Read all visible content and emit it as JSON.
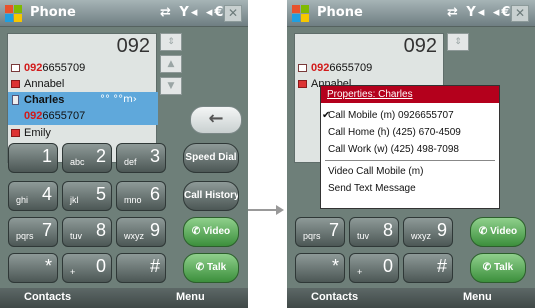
{
  "left": {
    "title": "Phone",
    "title_icons": "⇄ Y◂ ◂€",
    "close": "✕",
    "dial": "092",
    "expand": "⇕",
    "contacts": [
      {
        "prefix": "092",
        "rest": "6655709",
        "icon": "doc"
      },
      {
        "name": "Annabel",
        "icon": "red"
      },
      {
        "name": "Charles",
        "icon": "phone",
        "num_prefix": "092",
        "num_rest": "6655707",
        "dots": "°°  °°m›"
      },
      {
        "name": "Emily",
        "icon": "red"
      }
    ],
    "scroll_up": "▲",
    "scroll_down": "▼",
    "back": "←",
    "keys": [
      {
        "big": "1",
        "small": ""
      },
      {
        "big": "2",
        "small": "abc"
      },
      {
        "big": "3",
        "small": "def"
      },
      {
        "big": "4",
        "small": "ghi"
      },
      {
        "big": "5",
        "small": "jkl"
      },
      {
        "big": "6",
        "small": "mno"
      },
      {
        "big": "7",
        "small": "pqrs"
      },
      {
        "big": "8",
        "small": "tuv"
      },
      {
        "big": "9",
        "small": "wxyz"
      },
      {
        "big": "*",
        "small": ""
      },
      {
        "big": "0",
        "small": "+"
      },
      {
        "big": "#",
        "small": ""
      }
    ],
    "speed_dial": "Speed Dial",
    "call_history": "Call History",
    "video": "Video",
    "talk": "Talk",
    "soft_left": "Contacts",
    "soft_right": "Menu"
  },
  "right": {
    "title": "Phone",
    "title_icons": "⇄ Y◂ ◂€",
    "close": "✕",
    "dial": "092",
    "expand": "⇕",
    "bg_contacts": [
      {
        "prefix": "092",
        "rest": "6655709"
      },
      {
        "name": "Annabel"
      }
    ],
    "menu": {
      "title": "Properties: Charles",
      "items": [
        {
          "label": "Call Mobile (m) 0926655707",
          "check": "✔"
        },
        {
          "label": "Call Home (h) (425) 670-4509",
          "check": ""
        },
        {
          "label": "Call Work (w) (425) 498-7098",
          "check": ""
        },
        {
          "label": "Video Call Mobile (m)",
          "check": ""
        },
        {
          "label": "Send Text Message",
          "check": ""
        }
      ]
    },
    "video": "Video",
    "talk": "Talk",
    "soft_left": "Contacts",
    "soft_right": "Menu"
  },
  "colors": {
    "menu_header": "#b4001c",
    "talk_green": "#3c8f3c",
    "highlight": "#5fa8db"
  }
}
